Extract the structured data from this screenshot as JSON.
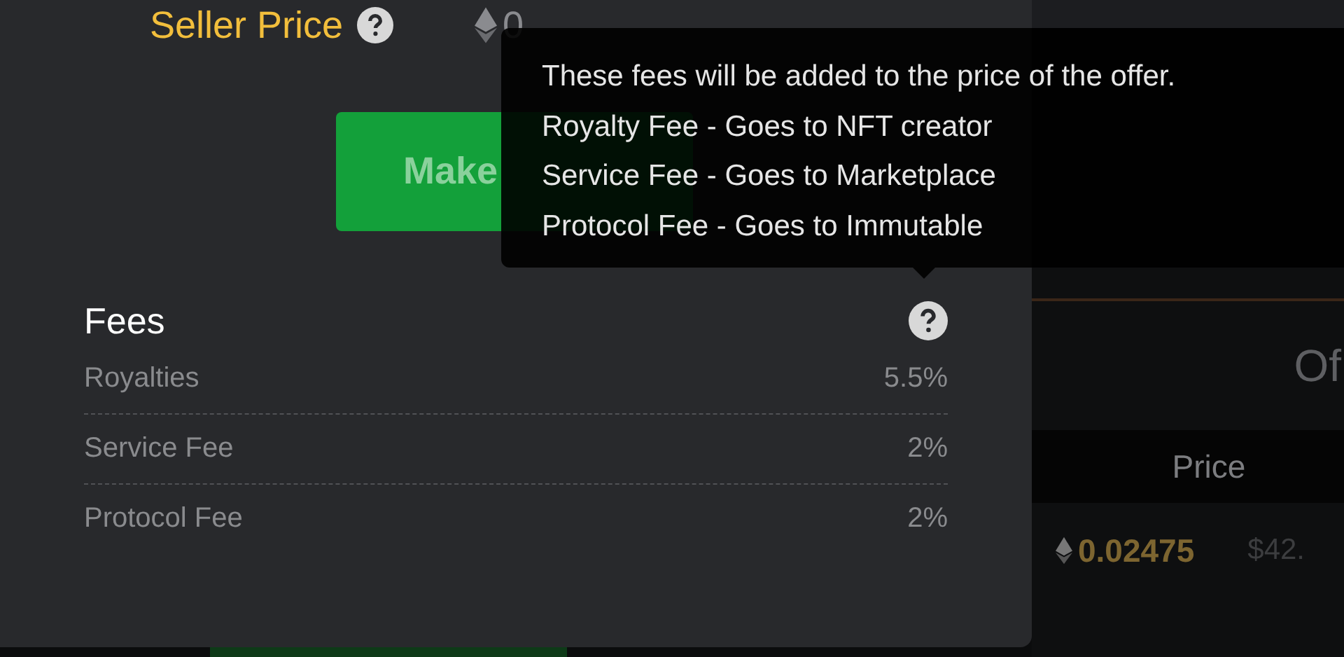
{
  "seller_price": {
    "label": "Seller Price",
    "value": "0"
  },
  "make_offer_button": {
    "label": "Make"
  },
  "tooltip": {
    "lines": [
      "These fees will be added to the price of the offer.",
      "Royalty Fee - Goes to NFT creator",
      "Service Fee - Goes to Marketplace",
      "Protocol Fee - Goes to Immutable"
    ]
  },
  "fees": {
    "title": "Fees",
    "rows": [
      {
        "label": "Royalties",
        "value": "5.5%"
      },
      {
        "label": "Service Fee",
        "value": "2%"
      },
      {
        "label": "Protocol Fee",
        "value": "2%"
      }
    ]
  },
  "background": {
    "heading": "Of",
    "table": {
      "columns": [
        "Price"
      ],
      "rows": [
        {
          "price": "0.02475",
          "usd": "$42."
        }
      ]
    }
  }
}
